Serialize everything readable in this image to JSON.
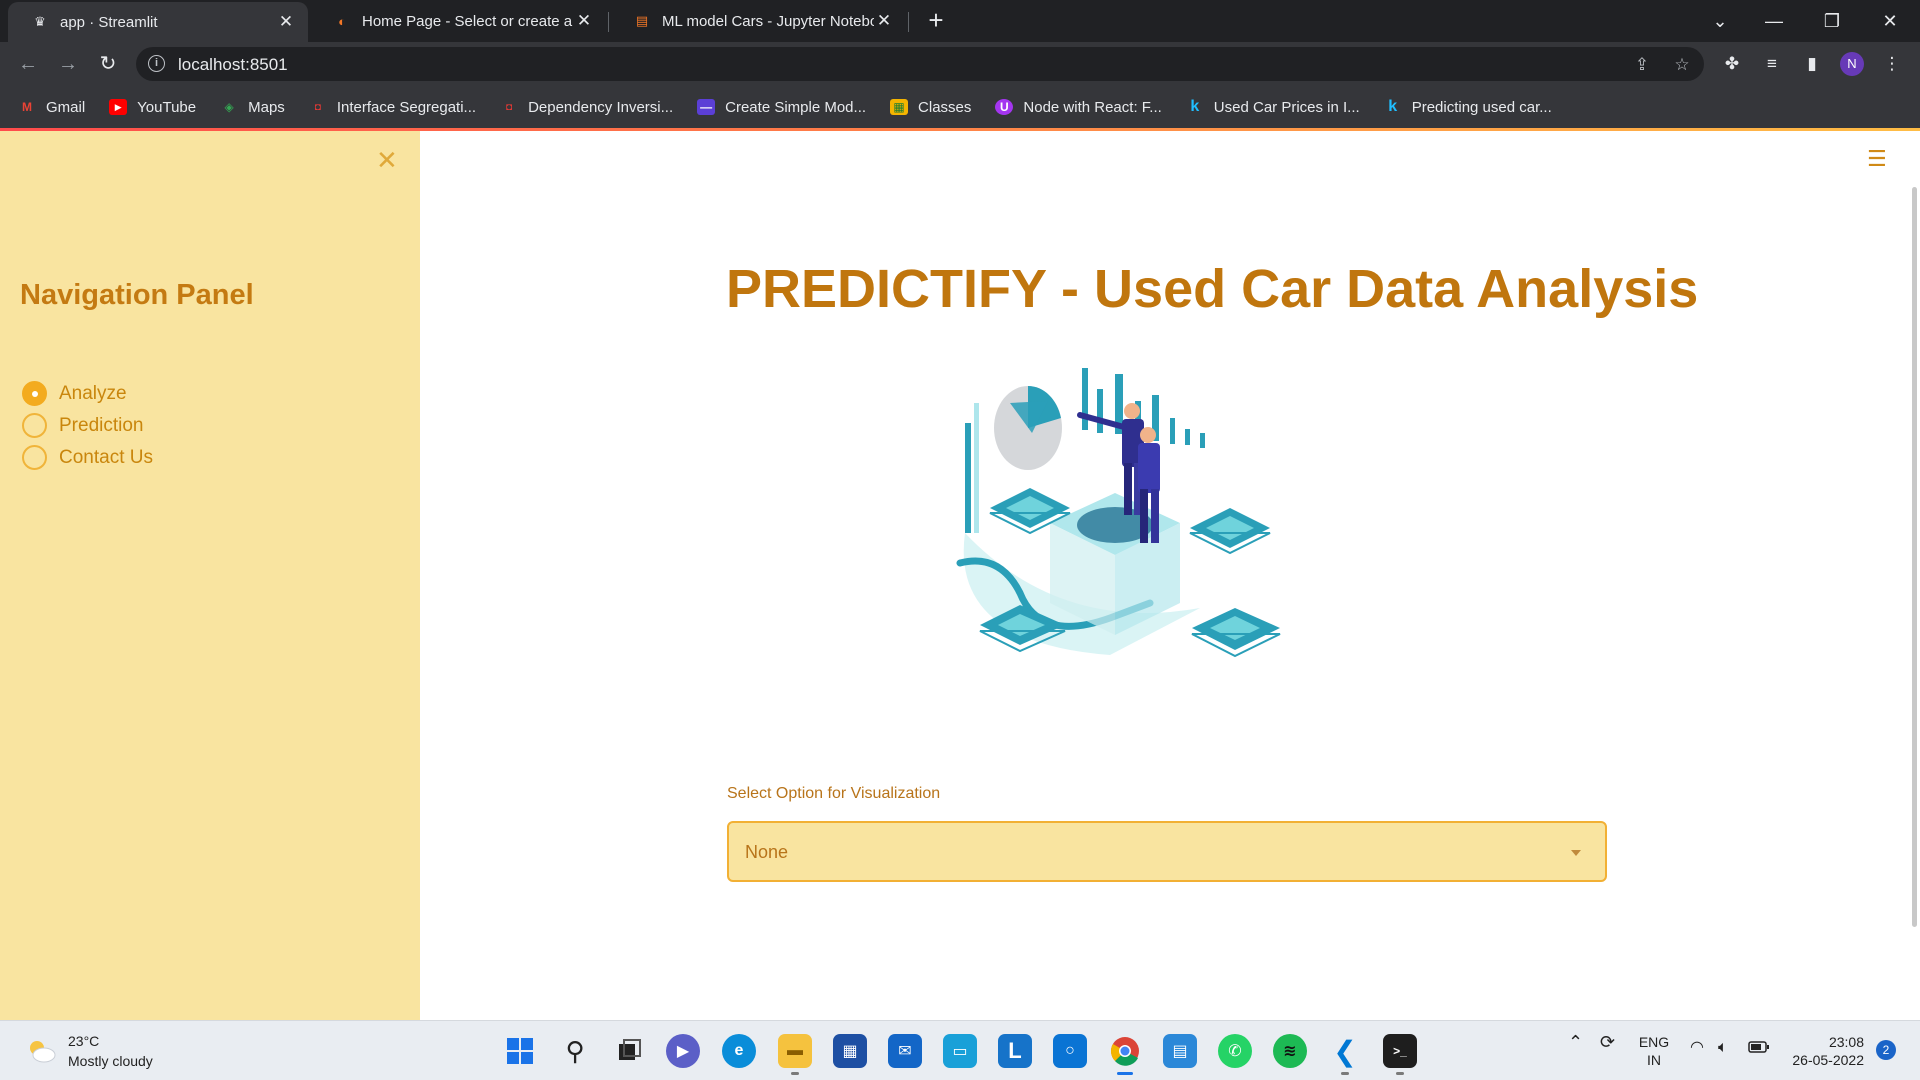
{
  "browser": {
    "tabs": [
      {
        "title": "app · Streamlit",
        "active": true
      },
      {
        "title": "Home Page - Select or create a n",
        "active": false
      },
      {
        "title": "ML model Cars - Jupyter Notebo",
        "active": false
      }
    ],
    "url": "localhost:8501",
    "profile_initial": "N",
    "bookmarks": [
      "Gmail",
      "YouTube",
      "Maps",
      "Interface Segregati...",
      "Dependency Inversi...",
      "Create Simple Mod...",
      "Classes",
      "Node with React: F...",
      "Used Car Prices in I...",
      "Predicting used car..."
    ]
  },
  "sidebar": {
    "title": "Navigation Panel",
    "options": [
      {
        "label": "Analyze",
        "checked": true
      },
      {
        "label": "Prediction",
        "checked": false
      },
      {
        "label": "Contact Us",
        "checked": false
      }
    ]
  },
  "main": {
    "title": "PREDICTIFY - Used Car Data Analysis",
    "select_label": "Select Option for Visualization",
    "select_value": "None"
  },
  "taskbar": {
    "temperature": "23°C",
    "weather": "Mostly cloudy",
    "language": "ENG",
    "region": "IN",
    "time": "23:08",
    "date": "26-05-2022",
    "notification_count": "2"
  },
  "colors": {
    "accent": "#c0760e",
    "sidebar_bg": "#f9e4a0",
    "radio_active": "#f3ab1f",
    "select_border": "#f2b034"
  }
}
